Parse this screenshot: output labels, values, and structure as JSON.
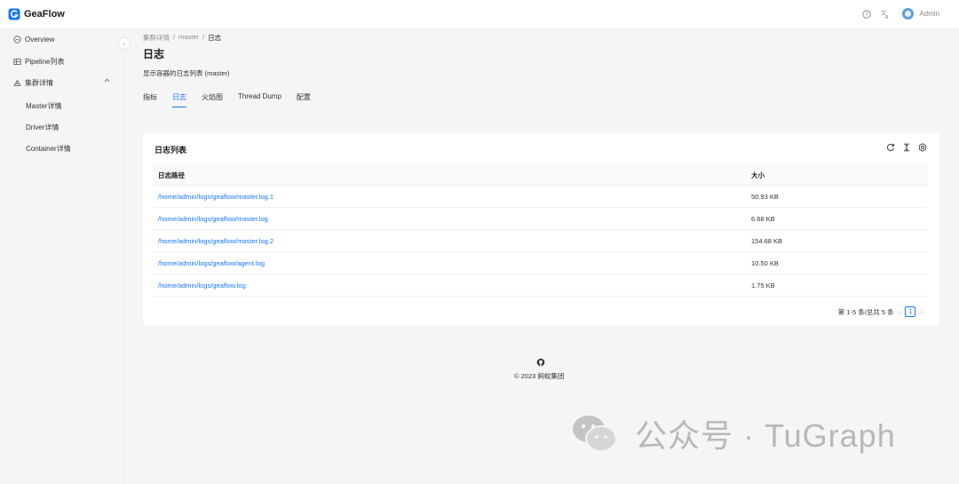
{
  "header": {
    "brand": "GeaFlow",
    "help_icon": "question-circle-icon",
    "lang_icon": "translate-icon",
    "user": "Admin"
  },
  "sidebar": {
    "items": [
      {
        "label": "Overview",
        "icon": "dashboard-icon"
      },
      {
        "label": "Pipeline列表",
        "icon": "table-icon"
      },
      {
        "label": "集群详情",
        "icon": "cluster-icon"
      }
    ],
    "sub_items": [
      {
        "label": "Master详情"
      },
      {
        "label": "Driver详情"
      },
      {
        "label": "Container详情"
      }
    ]
  },
  "breadcrumb": [
    "集群详情",
    "master",
    "日志"
  ],
  "page": {
    "title": "日志",
    "description": "显示容器的日志列表 (master)"
  },
  "tabs": [
    {
      "label": "指标",
      "active": false
    },
    {
      "label": "日志",
      "active": true
    },
    {
      "label": "火焰图",
      "active": false
    },
    {
      "label": "Thread Dump",
      "active": false
    },
    {
      "label": "配置",
      "active": false
    }
  ],
  "card": {
    "title": "日志列表",
    "tools": [
      "reload-icon",
      "column-height-icon",
      "settings-icon"
    ],
    "columns": {
      "path": "日志路径",
      "size": "大小"
    },
    "rows": [
      {
        "path": "/home/admin/logs/geaflow/master.log.1",
        "size": "50.93 KB"
      },
      {
        "path": "/home/admin/logs/geaflow/master.log",
        "size": "6.68 KB"
      },
      {
        "path": "/home/admin/logs/geaflow/master.log.2",
        "size": "154.68 KB"
      },
      {
        "path": "/home/admin/logs/geaflow/agent.log",
        "size": "10.50 KB"
      },
      {
        "path": "/home/admin/logs/geaflow.log",
        "size": "1.75 KB"
      }
    ],
    "pagination": {
      "summary": "第 1-5 条/总共 5 条",
      "current": "1"
    }
  },
  "footer": {
    "copyright": "© 2023 蚂蚁集团"
  },
  "watermark": {
    "text": "公众号 · TuGraph"
  },
  "colors": {
    "accent": "#1677ff",
    "bg": "#f5f5f5"
  }
}
